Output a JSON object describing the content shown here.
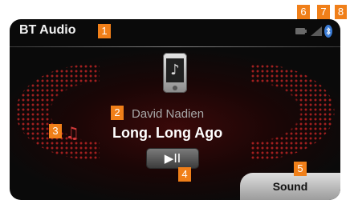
{
  "header": {
    "title": "BT Audio"
  },
  "track": {
    "artist": "David Nadien",
    "song": "Long. Long Ago"
  },
  "controls": {
    "play_pause_label": "▶II",
    "sound_label": "Sound"
  },
  "icons": {
    "phone": "smartphone-music-icon",
    "note": "music-note-icon",
    "status": [
      "battery-icon",
      "signal-strength-icon",
      "bluetooth-icon"
    ]
  },
  "callouts": [
    "1",
    "2",
    "3",
    "4",
    "5",
    "6",
    "7",
    "8"
  ],
  "colors": {
    "callout_bg": "#f07f19",
    "accent_red": "#d23a3a",
    "background": "#0a0a0a",
    "bluetooth": "#3a7bd5"
  }
}
